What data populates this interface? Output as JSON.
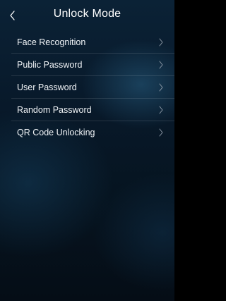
{
  "header": {
    "title": "Unlock Mode",
    "back_icon": "chevron-left-icon"
  },
  "menu": {
    "items": [
      {
        "label": "Face Recognition",
        "icon": "chevron-right-icon"
      },
      {
        "label": "Public Password",
        "icon": "chevron-right-icon"
      },
      {
        "label": "User Password",
        "icon": "chevron-right-icon"
      },
      {
        "label": "Random Password",
        "icon": "chevron-right-icon"
      },
      {
        "label": "QR Code Unlocking",
        "icon": "chevron-right-icon"
      }
    ]
  },
  "colors": {
    "background_top": "#0b2236",
    "background_bottom": "#050d16",
    "text": "#ffffff",
    "chevron": "#8a96a3"
  }
}
